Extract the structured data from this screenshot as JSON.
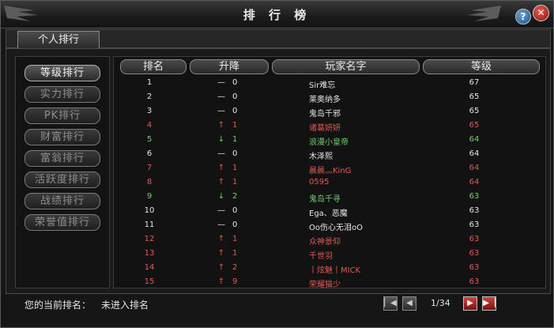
{
  "window": {
    "title": "排 行 榜",
    "help_icon": "question-icon",
    "close_icon": "close-icon",
    "help_label": "?",
    "close_label": "✕"
  },
  "tab": {
    "label": "个人排行"
  },
  "sidebar": {
    "items": [
      {
        "label": "等级排行",
        "active": true
      },
      {
        "label": "实力排行",
        "active": false
      },
      {
        "label": "PK排行",
        "active": false
      },
      {
        "label": "财富排行",
        "active": false
      },
      {
        "label": "富翁排行",
        "active": false
      },
      {
        "label": "活跃度排行",
        "active": false
      },
      {
        "label": "战绩排行",
        "active": false
      },
      {
        "label": "荣誉值排行",
        "active": false
      }
    ]
  },
  "table": {
    "headers": {
      "rank": "排名",
      "change": "升降",
      "name": "玩家名字",
      "level": "等级"
    },
    "rows": [
      {
        "rank": "1",
        "arrow": "—",
        "change": "0",
        "name": "Sir难忘",
        "level": "67",
        "color": "white"
      },
      {
        "rank": "2",
        "arrow": "—",
        "change": "0",
        "name": "莱奥纳多",
        "level": "65",
        "color": "white"
      },
      {
        "rank": "3",
        "arrow": "—",
        "change": "0",
        "name": "鬼岛千邪",
        "level": "65",
        "color": "white"
      },
      {
        "rank": "4",
        "arrow": "↑",
        "change": "1",
        "name": "诸葛妍妍",
        "level": "65",
        "color": "red"
      },
      {
        "rank": "5",
        "arrow": "↓",
        "change": "1",
        "name": "浪漫小皇帝",
        "level": "64",
        "color": "green"
      },
      {
        "rank": "6",
        "arrow": "—",
        "change": "0",
        "name": "木泽熙",
        "level": "64",
        "color": "white"
      },
      {
        "rank": "7",
        "arrow": "↑",
        "change": "1",
        "name": "晨晨灬KinG",
        "level": "64",
        "color": "red"
      },
      {
        "rank": "8",
        "arrow": "↑",
        "change": "1",
        "name": "0595",
        "level": "64",
        "color": "red"
      },
      {
        "rank": "9",
        "arrow": "↓",
        "change": "2",
        "name": "鬼岛千寻",
        "level": "63",
        "color": "green"
      },
      {
        "rank": "10",
        "arrow": "—",
        "change": "0",
        "name": "Ega、恶魔",
        "level": "63",
        "color": "white"
      },
      {
        "rank": "11",
        "arrow": "—",
        "change": "0",
        "name": "Oo伤心无泪oO",
        "level": "63",
        "color": "white"
      },
      {
        "rank": "12",
        "arrow": "↑",
        "change": "1",
        "name": "众神景仰",
        "level": "63",
        "color": "red"
      },
      {
        "rank": "13",
        "arrow": "↑",
        "change": "1",
        "name": "千世羽",
        "level": "63",
        "color": "red"
      },
      {
        "rank": "14",
        "arrow": "↑",
        "change": "2",
        "name": "丨炫魅丨MICK",
        "level": "63",
        "color": "red"
      },
      {
        "rank": "15",
        "arrow": "↑",
        "change": "9",
        "name": "荣耀猫少",
        "level": "63",
        "color": "red"
      }
    ]
  },
  "footer": {
    "current_rank_label": "您的当前排名：",
    "current_rank_value": "未进入排名",
    "page": "1/34",
    "first_icon": "first-page-icon",
    "prev_icon": "prev-page-icon",
    "next_icon": "next-page-icon",
    "last_icon": "last-page-icon",
    "first_glyph": "▏◀",
    "prev_glyph": "◀",
    "next_glyph": "▶",
    "last_glyph": "▶▕"
  }
}
